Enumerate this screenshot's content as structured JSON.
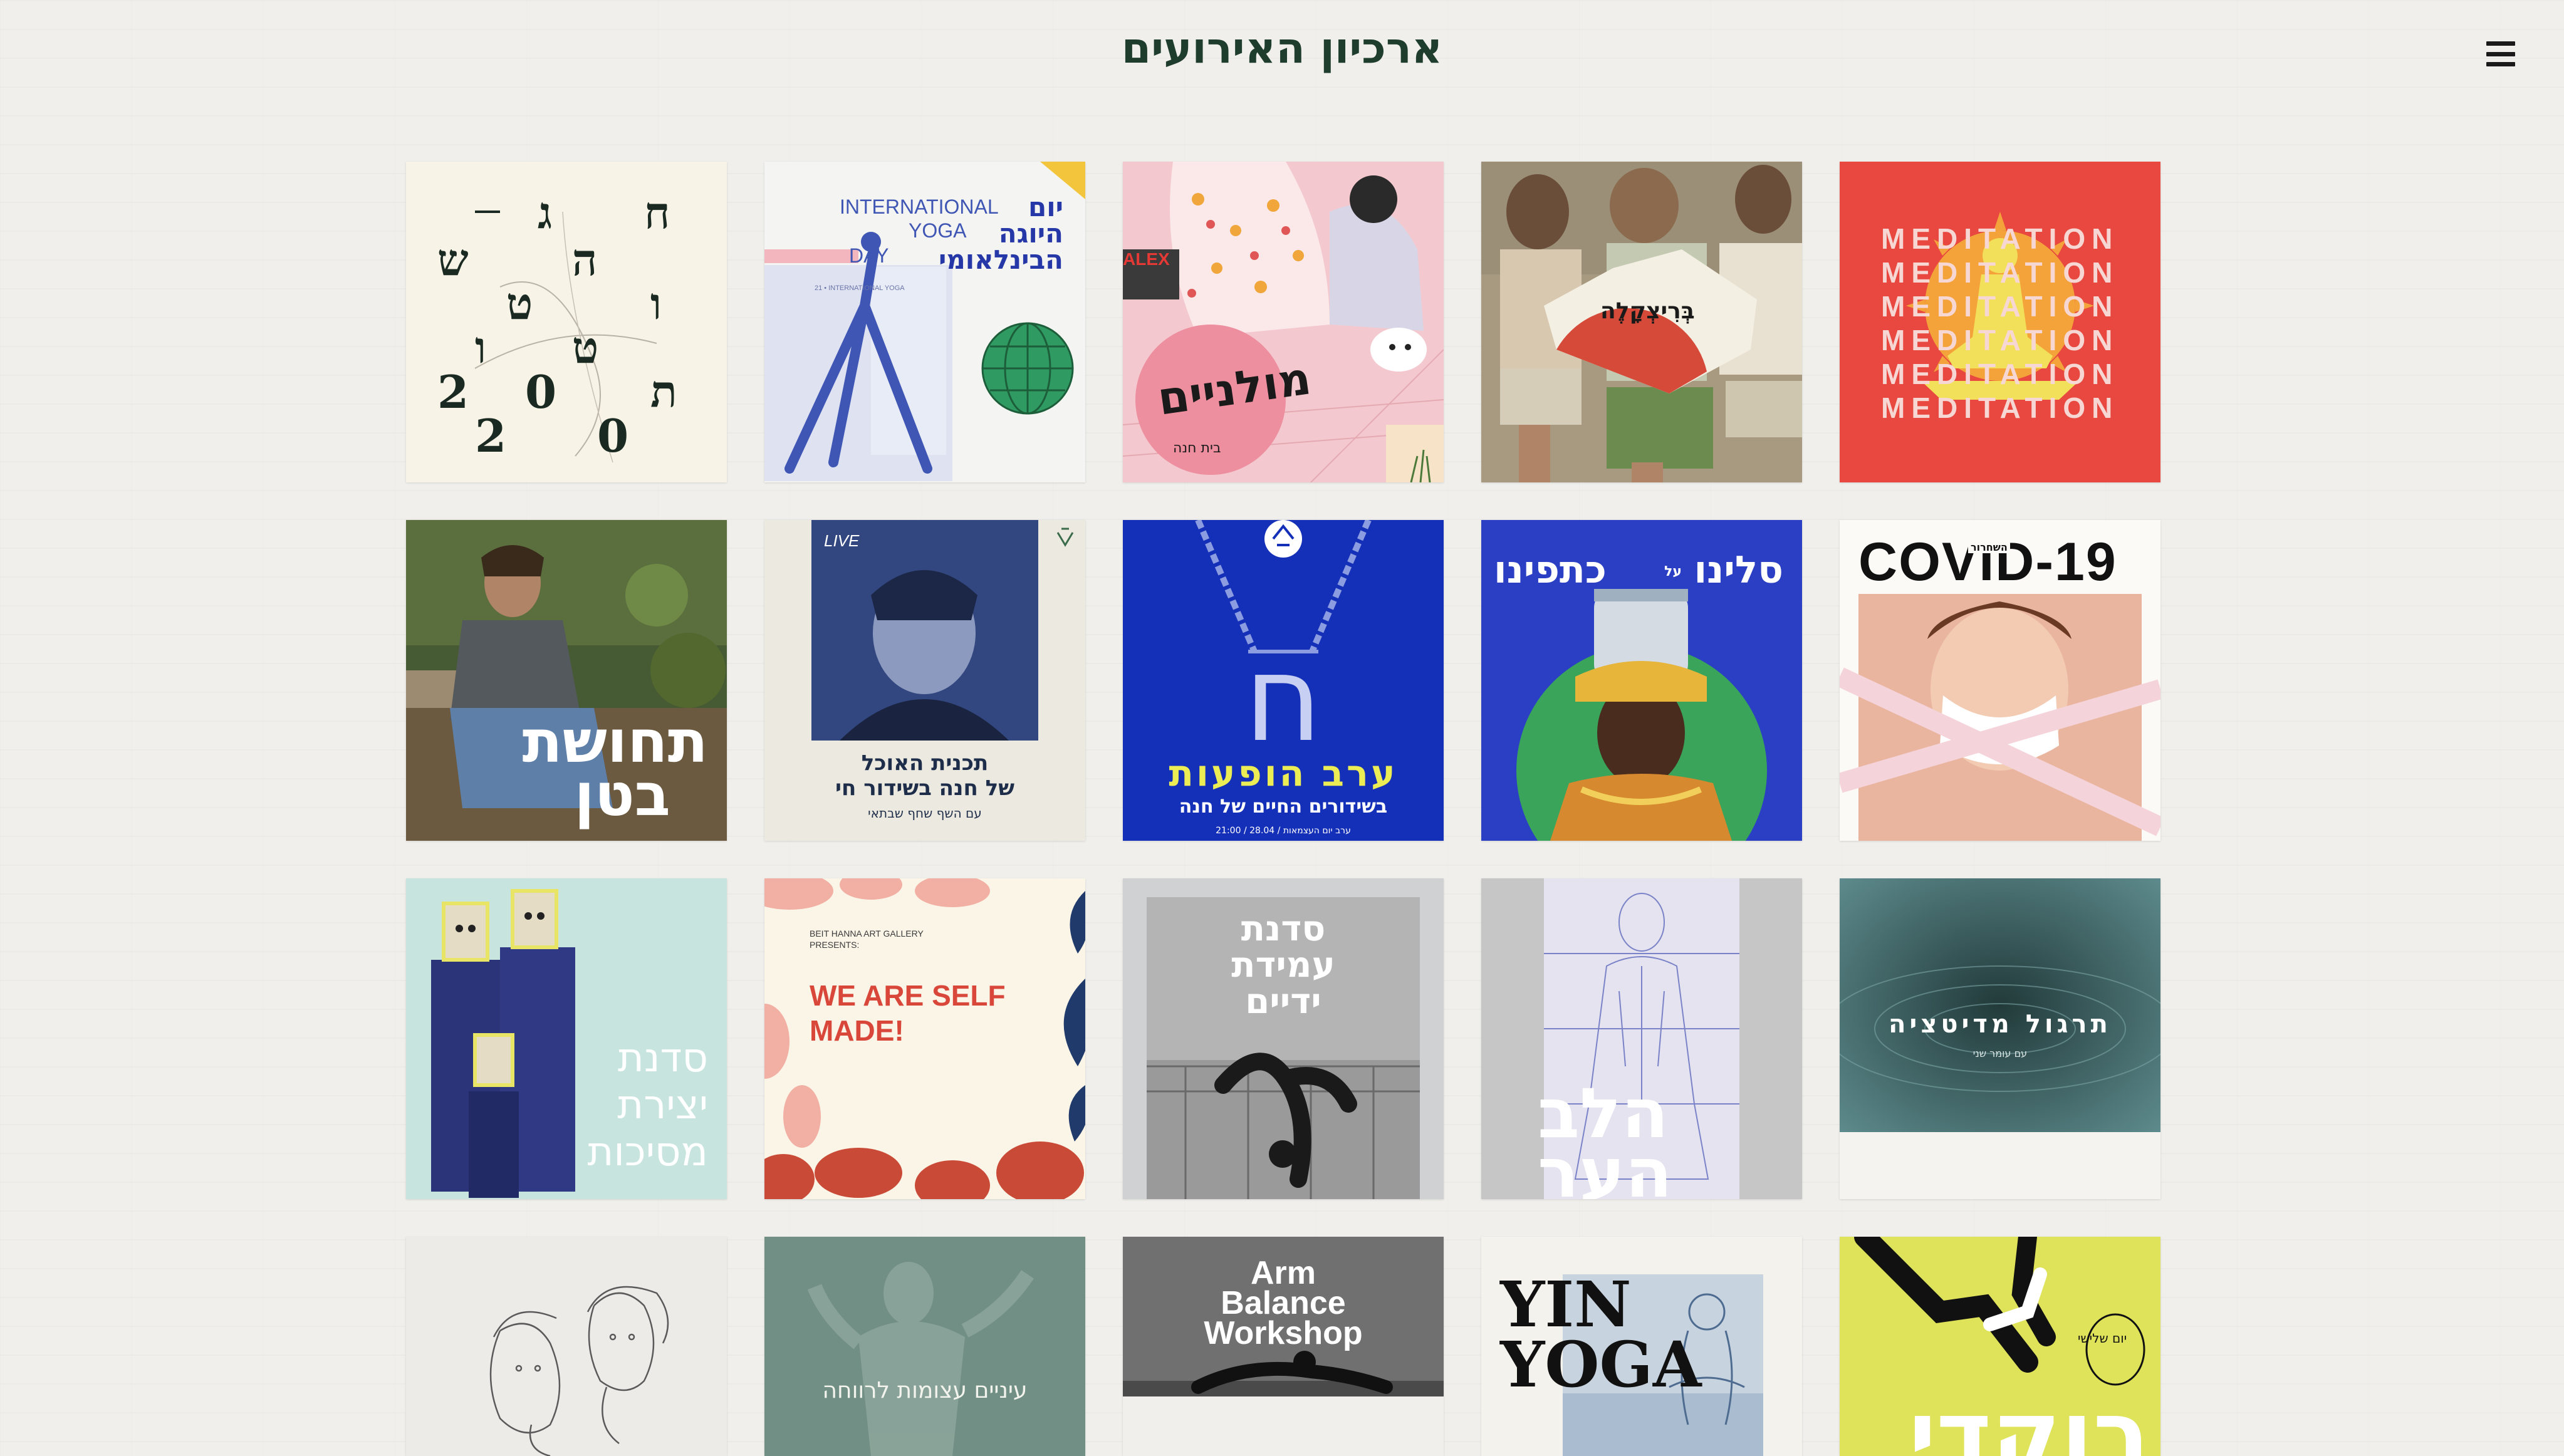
{
  "page": {
    "title": "ארכיון האירועים"
  },
  "menu": {
    "icon": "hamburger-menu-icon"
  },
  "cards": [
    {
      "id": "hagim-2020",
      "letters": [
        "ח",
        "ג",
        "ש",
        "ה",
        "ו",
        "ט",
        "ט",
        "ו",
        "ת"
      ],
      "year": [
        "2",
        "0",
        "2",
        "0"
      ]
    },
    {
      "id": "yoga-day",
      "en_line1": "INTERNATIONAL",
      "en_line2": "YOGA",
      "en_line3": "DAY",
      "he_line1": "יום",
      "he_line2": "היוגה",
      "he_line3": "הבינלאומי",
      "small_label": "21 • INTERNATIONAL YOGA"
    },
    {
      "id": "mulaneim",
      "title": "מולניים",
      "subtitle": "בית חנה",
      "netflix": "ALEX"
    },
    {
      "id": "brizkale",
      "title": "בְּרִיצְקָלֶה"
    },
    {
      "id": "meditation",
      "lines": [
        "MEDITATION",
        "MEDITATION",
        "MEDITATION",
        "MEDITATION",
        "MEDITATION",
        "MEDITATION"
      ]
    },
    {
      "id": "tchushat-beten",
      "line1": "תחושת",
      "line2": "בטן"
    },
    {
      "id": "food-program",
      "live": "LIVE",
      "line1": "תכנית האוכל",
      "line2": "של חנה בשידור חי",
      "line3": "עם השף שחף שבתאי"
    },
    {
      "id": "erev-hofaot",
      "title": "ערב הופעות",
      "subtitle": "בשידורים החיים של חנה",
      "footer": "ערב יום העצמאות / 28.04 / 21:00",
      "symbol": "ח"
    },
    {
      "id": "salino",
      "title": "סלינו",
      "small": "על",
      "title2": "כתפינו"
    },
    {
      "id": "covid",
      "title": "COVID-19",
      "small": "השחרור",
      "tape": "השחרור COVID-19"
    },
    {
      "id": "sadnat-yetzira",
      "line1": "סדנת",
      "line2": "יצירת",
      "line3": "מסיכות"
    },
    {
      "id": "self-made",
      "small1": "BEIT HANNA ART GALLERY",
      "small2": "PRESENTS:",
      "title1": "WE ARE SELF",
      "title2": "MADE!"
    },
    {
      "id": "handstand",
      "line1": "סדנת",
      "line2": "עמידת",
      "line3": "ידיים"
    },
    {
      "id": "halev-haer",
      "line1": "הלב",
      "line2": "הער"
    },
    {
      "id": "meditation-practice",
      "title": "תרגול מדיטציה",
      "subtitle": "עם עומר שני"
    },
    {
      "id": "faces",
      "label": ""
    },
    {
      "id": "eyes-closed",
      "title": "עיניים עצומות לרווחה"
    },
    {
      "id": "arm-balance",
      "line1": "Arm",
      "line2": "Balance",
      "line3": "Workshop"
    },
    {
      "id": "yin-yoga",
      "line1": "YIN",
      "line2": "YOGA"
    },
    {
      "id": "rikudei",
      "title": "רוקדי",
      "small": "יום שלישי"
    }
  ],
  "colors": {
    "background": "#f0efec",
    "title": "#1f3d2c",
    "meditation_red": "#e8483f",
    "blue": "#1530b8",
    "salino_blue": "#2a3fc4",
    "yellow_green": "#dfe35a"
  }
}
